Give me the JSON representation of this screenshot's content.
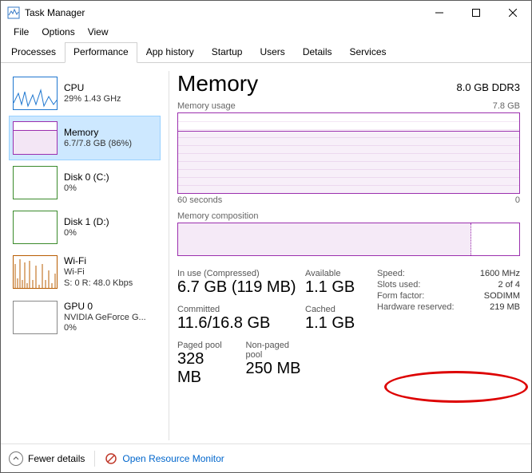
{
  "window": {
    "title": "Task Manager"
  },
  "menu": {
    "file": "File",
    "options": "Options",
    "view": "View"
  },
  "tabs": {
    "processes": "Processes",
    "performance": "Performance",
    "app_history": "App history",
    "startup": "Startup",
    "users": "Users",
    "details": "Details",
    "services": "Services"
  },
  "sidebar": [
    {
      "name": "CPU",
      "sub": "29% 1.43 GHz",
      "color": "#1f77d0"
    },
    {
      "name": "Memory",
      "sub": "6.7/7.8 GB (86%)",
      "color": "#9b2fae",
      "selected": true
    },
    {
      "name": "Disk 0 (C:)",
      "sub": "0%",
      "color": "#3a8a2a"
    },
    {
      "name": "Disk 1 (D:)",
      "sub": "0%",
      "color": "#3a8a2a"
    },
    {
      "name": "Wi-Fi",
      "sub": "Wi-Fi",
      "sub2": "S: 0 R: 48.0 Kbps",
      "color": "#b85c00"
    },
    {
      "name": "GPU 0",
      "sub": "NVIDIA GeForce G...",
      "sub2": "0%",
      "color": "#888"
    }
  ],
  "main": {
    "title": "Memory",
    "capacity": "8.0 GB DDR3",
    "usage_label": "Memory usage",
    "usage_max": "7.8 GB",
    "axis_left": "60 seconds",
    "axis_right": "0",
    "comp_label": "Memory composition",
    "stats": {
      "in_use_lbl": "In use (Compressed)",
      "in_use": "6.7 GB (119 MB)",
      "available_lbl": "Available",
      "available": "1.1 GB",
      "committed_lbl": "Committed",
      "committed": "11.6/16.8 GB",
      "cached_lbl": "Cached",
      "cached": "1.1 GB",
      "paged_lbl": "Paged pool",
      "paged": "328 MB",
      "nonpaged_lbl": "Non-paged pool",
      "nonpaged": "250 MB"
    },
    "kv": {
      "speed_k": "Speed:",
      "speed_v": "1600 MHz",
      "slots_k": "Slots used:",
      "slots_v": "2 of 4",
      "form_k": "Form factor:",
      "form_v": "SODIMM",
      "hw_k": "Hardware reserved:",
      "hw_v": "219 MB"
    }
  },
  "footer": {
    "fewer": "Fewer details",
    "rmon": "Open Resource Monitor"
  },
  "chart_data": {
    "type": "area",
    "title": "Memory usage",
    "ylabel": "GB",
    "ylim": [
      0,
      7.8
    ],
    "x_range_seconds": [
      60,
      0
    ],
    "series": [
      {
        "name": "In use",
        "values": [
          6.1,
          6.1,
          6.1,
          6.1,
          6.1,
          6.1,
          6.1,
          6.0,
          6.0,
          6.0,
          6.0,
          6.0
        ]
      }
    ],
    "composition": {
      "in_use_gb": 6.7,
      "total_gb": 7.8
    }
  }
}
